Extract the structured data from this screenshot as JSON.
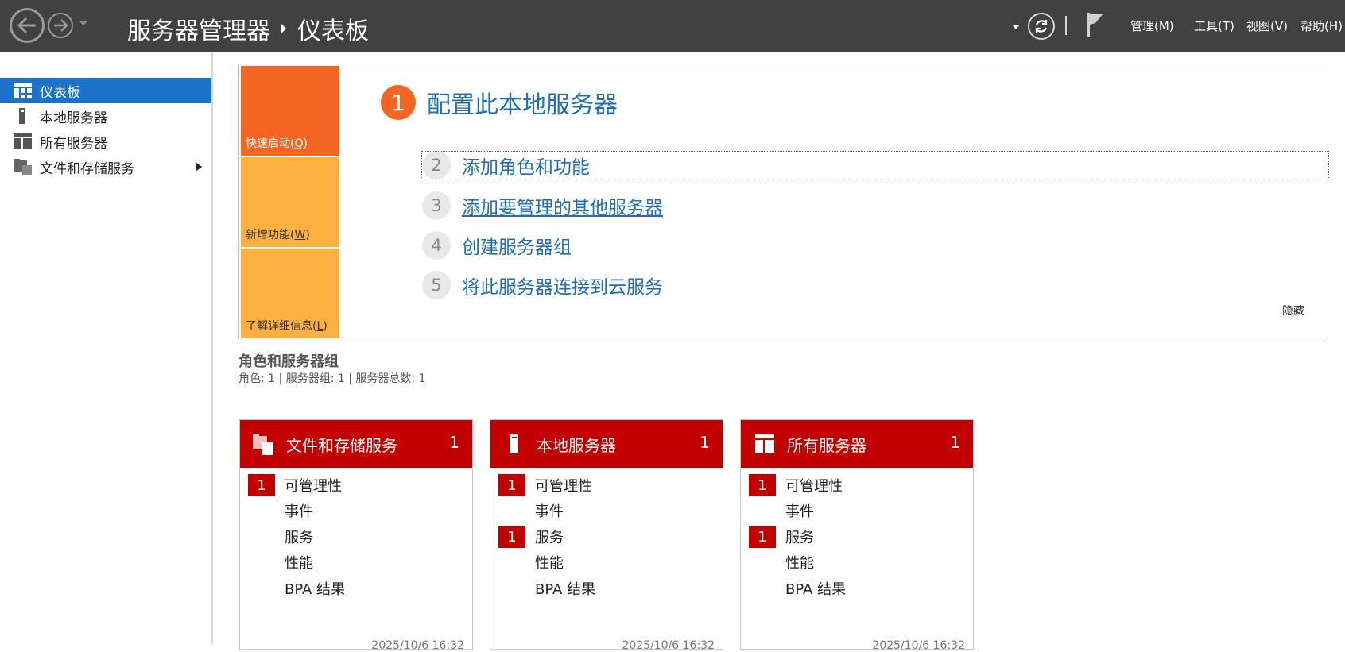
{
  "header": {
    "app_title": "服务器管理器",
    "page_title": "仪表板",
    "menus": [
      "管理(M)",
      "工具(T)",
      "视图(V)",
      "帮助(H)"
    ]
  },
  "sidebar": {
    "items": [
      {
        "label": "仪表板",
        "icon": "dashboard-icon",
        "active": true
      },
      {
        "label": "本地服务器",
        "icon": "server-icon"
      },
      {
        "label": "所有服务器",
        "icon": "servers-icon"
      },
      {
        "label": "文件和存储服务",
        "icon": "file-storage-icon",
        "expandable": true
      }
    ]
  },
  "welcome": {
    "quick_launch": [
      {
        "label": "快速启动(",
        "key": "Q",
        "suffix": ")"
      },
      {
        "label": "新增功能(",
        "key": "W",
        "suffix": ")"
      },
      {
        "label": "了解详细信息(",
        "key": "L",
        "suffix": ")"
      }
    ],
    "step1": {
      "num": "1",
      "label": "配置此本地服务器"
    },
    "steps": [
      {
        "num": "2",
        "label": "添加角色和功能"
      },
      {
        "num": "3",
        "label": "添加要管理的其他服务器"
      },
      {
        "num": "4",
        "label": "创建服务器组"
      },
      {
        "num": "5",
        "label": "将此服务器连接到云服务"
      }
    ],
    "hide": "隐藏"
  },
  "roles_section": {
    "title": "角色和服务器组",
    "summary": "角色: 1 | 服务器组: 1 | 服务器总数: 1"
  },
  "tiles": [
    {
      "name": "文件和存储服务",
      "count": "1",
      "icon": "file-storage-icon",
      "rows": [
        {
          "label": "可管理性",
          "badge": "1"
        },
        {
          "label": "事件",
          "badge": ""
        },
        {
          "label": "服务",
          "badge": ""
        },
        {
          "label": "性能",
          "badge": ""
        },
        {
          "label": "BPA 结果",
          "badge": ""
        }
      ],
      "timestamp": "2025/10/6 16:32"
    },
    {
      "name": "本地服务器",
      "count": "1",
      "icon": "server-icon",
      "rows": [
        {
          "label": "可管理性",
          "badge": "1"
        },
        {
          "label": "事件",
          "badge": ""
        },
        {
          "label": "服务",
          "badge": "1"
        },
        {
          "label": "性能",
          "badge": ""
        },
        {
          "label": "BPA 结果",
          "badge": ""
        }
      ],
      "timestamp": "2025/10/6 16:32"
    },
    {
      "name": "所有服务器",
      "count": "1",
      "icon": "servers-icon",
      "rows": [
        {
          "label": "可管理性",
          "badge": "1"
        },
        {
          "label": "事件",
          "badge": ""
        },
        {
          "label": "服务",
          "badge": "1"
        },
        {
          "label": "性能",
          "badge": ""
        },
        {
          "label": "BPA 结果",
          "badge": ""
        }
      ],
      "timestamp": "2025/10/6 16:32"
    }
  ],
  "colors": {
    "topbar": "#414141",
    "sidebar_active": "#1a73c8",
    "tile_red": "#c20000",
    "quick_orange": "#f26522",
    "quick_amber": "#fbb040",
    "link_blue": "#1f6fb6"
  }
}
